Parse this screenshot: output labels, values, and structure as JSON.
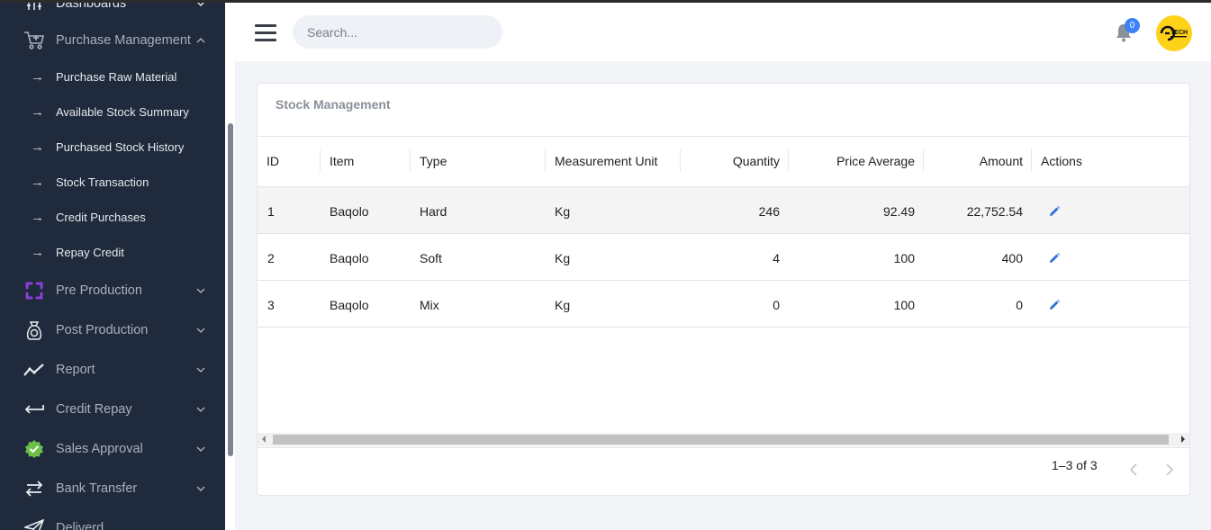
{
  "sidebar": {
    "items": [
      {
        "label": "Dashboards",
        "icon": "dashboards-icon"
      },
      {
        "label": "Purchase Management",
        "icon": "cart-icon",
        "expanded": true
      },
      {
        "label": "Pre Production",
        "icon": "pre-production-icon"
      },
      {
        "label": "Post Production",
        "icon": "money-bag-icon"
      },
      {
        "label": "Report",
        "icon": "trend-line-icon"
      },
      {
        "label": "Credit Repay",
        "icon": "return-arrow-icon"
      },
      {
        "label": "Sales Approval",
        "icon": "check-badge-icon"
      },
      {
        "label": "Bank Transfer",
        "icon": "swap-arrows-icon"
      },
      {
        "label": "Deliverd",
        "icon": "send-icon"
      }
    ],
    "submenu": [
      {
        "label": "Purchase Raw Material"
      },
      {
        "label": "Available Stock Summary"
      },
      {
        "label": "Purchased Stock History"
      },
      {
        "label": "Stock Transaction"
      },
      {
        "label": "Credit Purchases"
      },
      {
        "label": "Repay Credit"
      }
    ],
    "submenu_arrow": "→"
  },
  "header": {
    "search_placeholder": "Search...",
    "notifications_count": "0",
    "avatar_text": "TECH"
  },
  "card": {
    "title": "Stock Management"
  },
  "table": {
    "columns": [
      "ID",
      "Item",
      "Type",
      "Measurement Unit",
      "Quantity",
      "Price Average",
      "Amount",
      "Actions"
    ],
    "rows": [
      {
        "id": "1",
        "item": "Baqolo",
        "type": "Hard",
        "unit": "Kg",
        "quantity": "246",
        "price_average": "92.49",
        "amount": "22,752.54"
      },
      {
        "id": "2",
        "item": "Baqolo",
        "type": "Soft",
        "unit": "Kg",
        "quantity": "4",
        "price_average": "100",
        "amount": "400"
      },
      {
        "id": "3",
        "item": "Baqolo",
        "type": "Mix",
        "unit": "Kg",
        "quantity": "0",
        "price_average": "100",
        "amount": "0"
      }
    ],
    "pagination": "1–3 of 3"
  },
  "colors": {
    "sidebar_bg": "#1f2a3c",
    "accent_blue": "#3b82f6",
    "avatar_yellow": "#ffd21a",
    "edit_icon": "#2f6fd6"
  }
}
